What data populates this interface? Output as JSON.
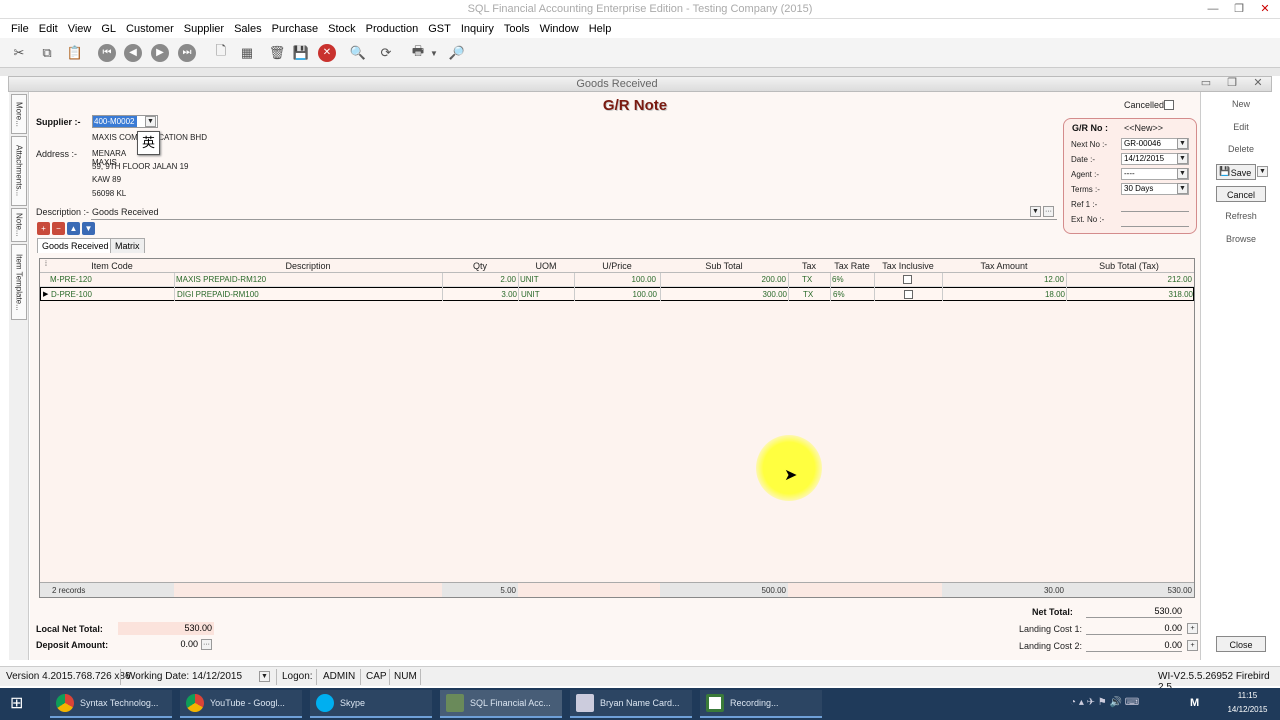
{
  "app": {
    "title": "SQL Financial Accounting Enterprise Edition - Testing Company (2015)",
    "child_title": "Goods Received"
  },
  "menu": [
    "File",
    "Edit",
    "View",
    "GL",
    "Customer",
    "Supplier",
    "Sales",
    "Purchase",
    "Stock",
    "Production",
    "GST",
    "Inquiry",
    "Tools",
    "Window",
    "Help"
  ],
  "side_tabs": [
    "More...",
    "Attachments...",
    "Note...",
    "Item Template..."
  ],
  "form": {
    "heading": "G/R Note",
    "cancelled_label": "Cancelled",
    "supplier_label": "Supplier :-",
    "supplier_code": "400-M0002",
    "ime_glyph": "英",
    "supplier_name": "MAXIS COMMUNICATION BHD",
    "address_label": "Address :-",
    "address_lines": [
      "MENARA MAXIS",
      "59, 9TH FLOOR JALAN 19",
      "KAW 89",
      "56098 KL"
    ],
    "description_label": "Description :-",
    "description": "Goods Received",
    "ellipsis": "···"
  },
  "doc_box": {
    "no_label": "G/R No :",
    "no_value": "<<New>>",
    "next_no_label": "Next No :-",
    "next_no": "GR-00046",
    "date_label": "Date :-",
    "date": "14/12/2015",
    "agent_label": "Agent :-",
    "agent": "----",
    "terms_label": "Terms :-",
    "terms": "30 Days",
    "ref1_label": "Ref 1 :-",
    "ext_no_label": "Ext. No :-"
  },
  "tabs": [
    "Goods Received",
    "Matrix"
  ],
  "grid": {
    "columns": [
      "Item Code",
      "Description",
      "Qty",
      "UOM",
      "U/Price",
      "Sub Total",
      "Tax",
      "Tax Rate",
      "Tax Inclusive",
      "Tax Amount",
      "Sub Total (Tax)"
    ],
    "rows": [
      {
        "code": "M-PRE-120",
        "desc": "MAXIS PREPAID-RM120",
        "qty": "2.00",
        "uom": "UNIT",
        "price": "100.00",
        "sub": "200.00",
        "tax": "TX",
        "rate": "6%",
        "taxamt": "12.00",
        "subtax": "212.00"
      },
      {
        "code": "D-PRE-100",
        "desc": "DIGI PREPAID-RM100",
        "qty": "3.00",
        "uom": "UNIT",
        "price": "100.00",
        "sub": "300.00",
        "tax": "TX",
        "rate": "6%",
        "taxamt": "18.00",
        "subtax": "318.00"
      }
    ],
    "footer": {
      "records": "2 records",
      "qty": "5.00",
      "sub": "500.00",
      "taxamt": "30.00",
      "subtax": "530.00"
    }
  },
  "right_buttons": [
    "New",
    "Edit",
    "Delete",
    "Save",
    "Cancel",
    "Refresh",
    "Browse",
    "Close"
  ],
  "totals": {
    "local_net_label": "Local Net Total:",
    "local_net": "530.00",
    "deposit_label": "Deposit Amount:",
    "deposit": "0.00",
    "net_label": "Net Total:",
    "net": "530.00",
    "landing1_label": "Landing Cost 1:",
    "landing1": "0.00",
    "landing2_label": "Landing Cost 2:",
    "landing2": "0.00"
  },
  "status": {
    "version": "Version 4.2015.768.726 x86",
    "working_date_label": "Working Date:",
    "working_date": "14/12/2015",
    "logon_label": "Logon:",
    "user": "ADMIN",
    "cap": "CAP",
    "num": "NUM",
    "build": "WI-V2.5.5.26952 Firebird 2.5"
  },
  "taskbar": {
    "items": [
      "Syntax Technolog...",
      "YouTube - Googl...",
      "Skype",
      "SQL Financial Acc...",
      "Bryan Name Card...",
      "Recording..."
    ],
    "time": "11:15",
    "date": "14/12/2015"
  },
  "colors": {
    "accent": "#7a1a10",
    "grid_text": "#2a6a2a",
    "form_bg": "#fdf7f4",
    "taskbar": "#1f3a5a"
  }
}
